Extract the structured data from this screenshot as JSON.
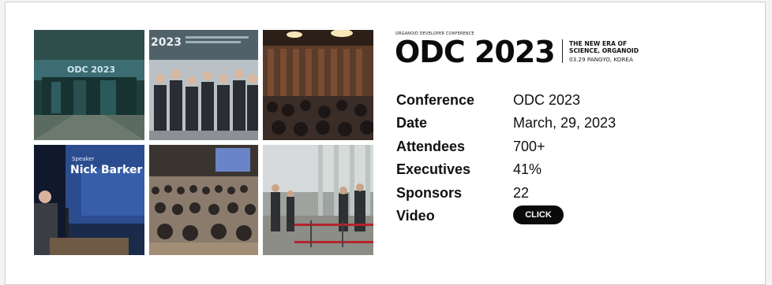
{
  "gallery": {
    "photo1": {
      "sign_text": "ODC 2023",
      "icon": "venue-entrance-photo"
    },
    "photo2": {
      "banner_year": "2023",
      "icon": "group-photo"
    },
    "photo3": {
      "icon": "audience-photo"
    },
    "photo4": {
      "speaker_title": "Speaker",
      "speaker_name": "Nick Barker",
      "icon": "speaker-photo"
    },
    "photo5": {
      "icon": "hall-photo"
    },
    "photo6": {
      "icon": "lobby-photo"
    }
  },
  "logo": {
    "small": "ORGANOID DEVELOPER CONFERENCE",
    "big": "ODC 2023",
    "tagline_line1": "THE NEW ERA OF",
    "tagline_line2": "SCIENCE, ORGANOID",
    "subline": "03.29 PANGYO, KOREA"
  },
  "facts": [
    {
      "label": "Conference",
      "value": "ODC 2023"
    },
    {
      "label": "Date",
      "value": "March, 29, 2023"
    },
    {
      "label": "Attendees",
      "value": "700+"
    },
    {
      "label": "Executives",
      "value": "41%"
    },
    {
      "label": "Sponsors",
      "value": "22"
    },
    {
      "label": "Video",
      "button": "CLICK"
    }
  ],
  "colors": {
    "accent": "#0a0a0a",
    "border": "#cfcfcf"
  }
}
